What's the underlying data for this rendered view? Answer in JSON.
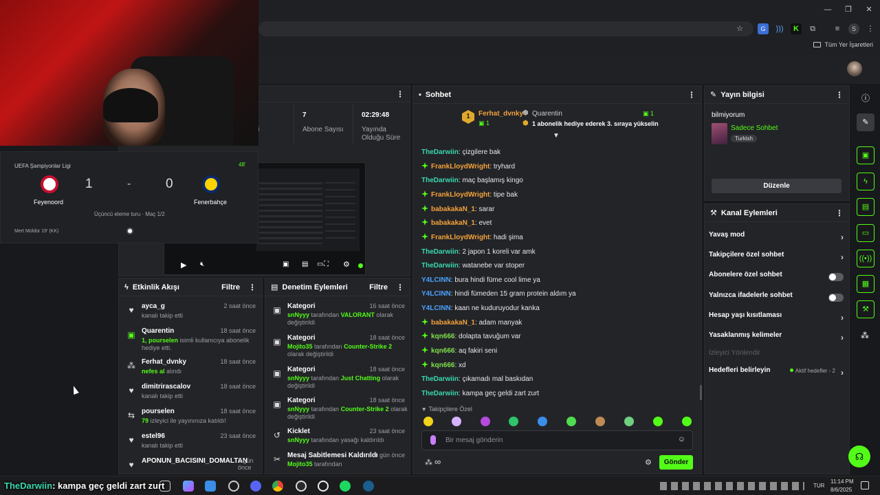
{
  "browser": {
    "bookmarks_label": "Tüm Yer İşaretleri"
  },
  "stats": [
    {
      "value": "",
      "label": "çi"
    },
    {
      "value": "7",
      "label": "Abone Sayısı"
    },
    {
      "value": "02:29:48",
      "label": "Yayında Olduğu Süre"
    }
  ],
  "score": {
    "league": "UEFA Şampiyonlar Ligi",
    "minute": "48'",
    "home": "Feyenoord",
    "away": "Fenerbahçe",
    "home_score": "1",
    "separator": "-",
    "away_score": "0",
    "round": "Üçüncü eleme turu · Maç 1/2",
    "event": "Mert Müldür 19' (KK)"
  },
  "chat": {
    "title": "Sohbet",
    "pinned": {
      "rank": "1",
      "user1": "Ferhat_dvnky",
      "user1_count": "1",
      "user2": "Quarentin",
      "user2_count": "1",
      "message": "1 abonelik hediye ederek 3. sıraya yükselin"
    },
    "messages": [
      {
        "user": "TheDarwiin",
        "text": ": çizgilere bak",
        "style": "teal",
        "badge": false
      },
      {
        "user": "FrankLloydWright",
        "text": ": tryhard",
        "style": "orange",
        "badge": true
      },
      {
        "user": "TheDarwiin",
        "text": ": maç başlamış kingo",
        "style": "teal",
        "badge": false
      },
      {
        "user": "FrankLloydWright",
        "text": ": tipe bak",
        "style": "orange",
        "badge": true
      },
      {
        "user": "babakakaN_1",
        "text": ": sarar",
        "style": "orange",
        "badge": true
      },
      {
        "user": "babakakaN_1",
        "text": ": evet",
        "style": "orange",
        "badge": true
      },
      {
        "user": "FrankLloydWright",
        "text": ": hadi şima",
        "style": "orange",
        "badge": true
      },
      {
        "user": "TheDarwiin",
        "text": ": 2 japon 1 koreli var amk",
        "style": "teal",
        "badge": false
      },
      {
        "user": "TheDarwiin",
        "text": ": watanebe var stoper",
        "style": "teal",
        "badge": false
      },
      {
        "user": "Y4LCINN",
        "text": ": bura hindi füme cool lime ya",
        "style": "blue",
        "badge": false
      },
      {
        "user": "Y4LCINN",
        "text": ": hindi fümeden 15 gram protein aldım ya",
        "style": "blue",
        "badge": false
      },
      {
        "user": "Y4LCINN",
        "text": ": kaan ne kuduruyodur kanka",
        "style": "blue",
        "badge": false
      },
      {
        "user": "babakakaN_1",
        "text": ": adam manyak",
        "style": "orange",
        "badge": true
      },
      {
        "user": "kqn666",
        "text": ": dolapta tavuğum var",
        "style": "green",
        "badge": true
      },
      {
        "user": "kqn666",
        "text": ": aq fakiri seni",
        "style": "green",
        "badge": true
      },
      {
        "user": "kqn666",
        "text": ": xd",
        "style": "green",
        "badge": true
      },
      {
        "user": "TheDarwiin",
        "text": ": çıkamadı mal baskıdan",
        "style": "teal",
        "badge": false
      },
      {
        "user": "TheDarwiin",
        "text": ": kampa geç geldi zart zurt",
        "style": "teal",
        "badge": false
      }
    ],
    "followers_emotes_label": "Takipçilere Özel",
    "input_placeholder": "Bir mesaj gönderin",
    "send_label": "Gönder"
  },
  "activity": {
    "title": "Etkinlik Akışı",
    "filter": "Filtre",
    "items": [
      {
        "name": "ayca_g",
        "time": "2 saat önce",
        "sub": "kanalı takip etti",
        "icon": "heart-icon"
      },
      {
        "name": "Quarentin",
        "time": "18 saat önce",
        "sub_hl": "1, pourselen",
        "sub": " isimli kullanıcıya abonelik hediye etti.",
        "icon": "gift-icon"
      },
      {
        "name": "Ferhat_dvnky",
        "time": "18 saat önce",
        "sub_hl": "nefes al",
        "sub": " alındı",
        "icon": "reward-icon"
      },
      {
        "name": "dimitrirascalov",
        "time": "18 saat önce",
        "sub": "kanalı takip etti",
        "icon": "heart-icon"
      },
      {
        "name": "pourselen",
        "time": "18 saat önce",
        "sub_hl": "79",
        "sub": " izleyici ile yayınınıza katıldı!",
        "icon": "raid-icon"
      },
      {
        "name": "estel96",
        "time": "23 saat önce",
        "sub": "kanalı takip etti",
        "icon": "heart-icon"
      },
      {
        "name": "APONUN_BACISINI_DOMALTAN",
        "time": "1 gün önce",
        "sub": "",
        "icon": "heart-icon"
      }
    ]
  },
  "moderation": {
    "title": "Denetim Eylemleri",
    "filter": "Filtre",
    "items": [
      {
        "name": "Kategori",
        "time": "16 saat önce",
        "user": "snNyyy",
        "mid": " tarafından ",
        "target": "VALORANT",
        "end": " olarak değiştirildi"
      },
      {
        "name": "Kategori",
        "time": "18 saat önce",
        "user": "Mojito35",
        "mid": " tarafından ",
        "target": "Counter-Strike 2",
        "end": " olarak değiştirildi"
      },
      {
        "name": "Kategori",
        "time": "18 saat önce",
        "user": "snNyyy",
        "mid": " tarafından ",
        "target": "Just Chatting",
        "end": " olarak değiştirildi"
      },
      {
        "name": "Kategori",
        "time": "18 saat önce",
        "user": "snNyyy",
        "mid": " tarafından ",
        "target": "Counter-Strike 2",
        "end": " olarak değiştirildi"
      },
      {
        "name": "Kicklet",
        "time": "23 saat önce",
        "user": "snNyyy",
        "mid": " tarafından yasağı kaldırıldı",
        "target": "",
        "end": ""
      },
      {
        "name": "Mesaj Sabitlemesi Kaldırıldı",
        "time": "1 gün önce",
        "user": "Mojito35",
        "mid": " tarafından",
        "target": "",
        "end": ""
      }
    ]
  },
  "stream_info": {
    "title": "Yayın bilgisi",
    "stream_title": "bilmiyorum",
    "category": "Sadece Sohbet",
    "language": "Turkish",
    "edit_label": "Düzenle"
  },
  "channel_actions": {
    "title": "Kanal Eylemleri",
    "items": [
      {
        "label": "Yavaş mod",
        "type": "chevron"
      },
      {
        "label": "Takipçilere özel sohbet",
        "type": "chevron"
      },
      {
        "label": "Abonelere özel sohbet",
        "type": "toggle"
      },
      {
        "label": "Yalnızca ifadelerle sohbet",
        "type": "toggle"
      },
      {
        "label": "Hesap yaşı kısıtlaması",
        "type": "chevron"
      },
      {
        "label": "Yasaklanmış kelimeler",
        "type": "chevron"
      },
      {
        "label": "İzleyici Yönlendir",
        "type": "disabled"
      },
      {
        "label": "Hedefleri belirleyin",
        "type": "goal",
        "extra": "Aktif hedefler - 2"
      }
    ]
  },
  "overlay_chat": {
    "user": "TheDarwiin",
    "text": ": kampa geç geldi zart zurt"
  },
  "taskbar": {
    "lang": "TUR",
    "time": "11:14 PM",
    "date": "8/6/2025"
  },
  "colors": {
    "accent": "#53fc18",
    "background": "#18191c",
    "panel": "#232428"
  }
}
